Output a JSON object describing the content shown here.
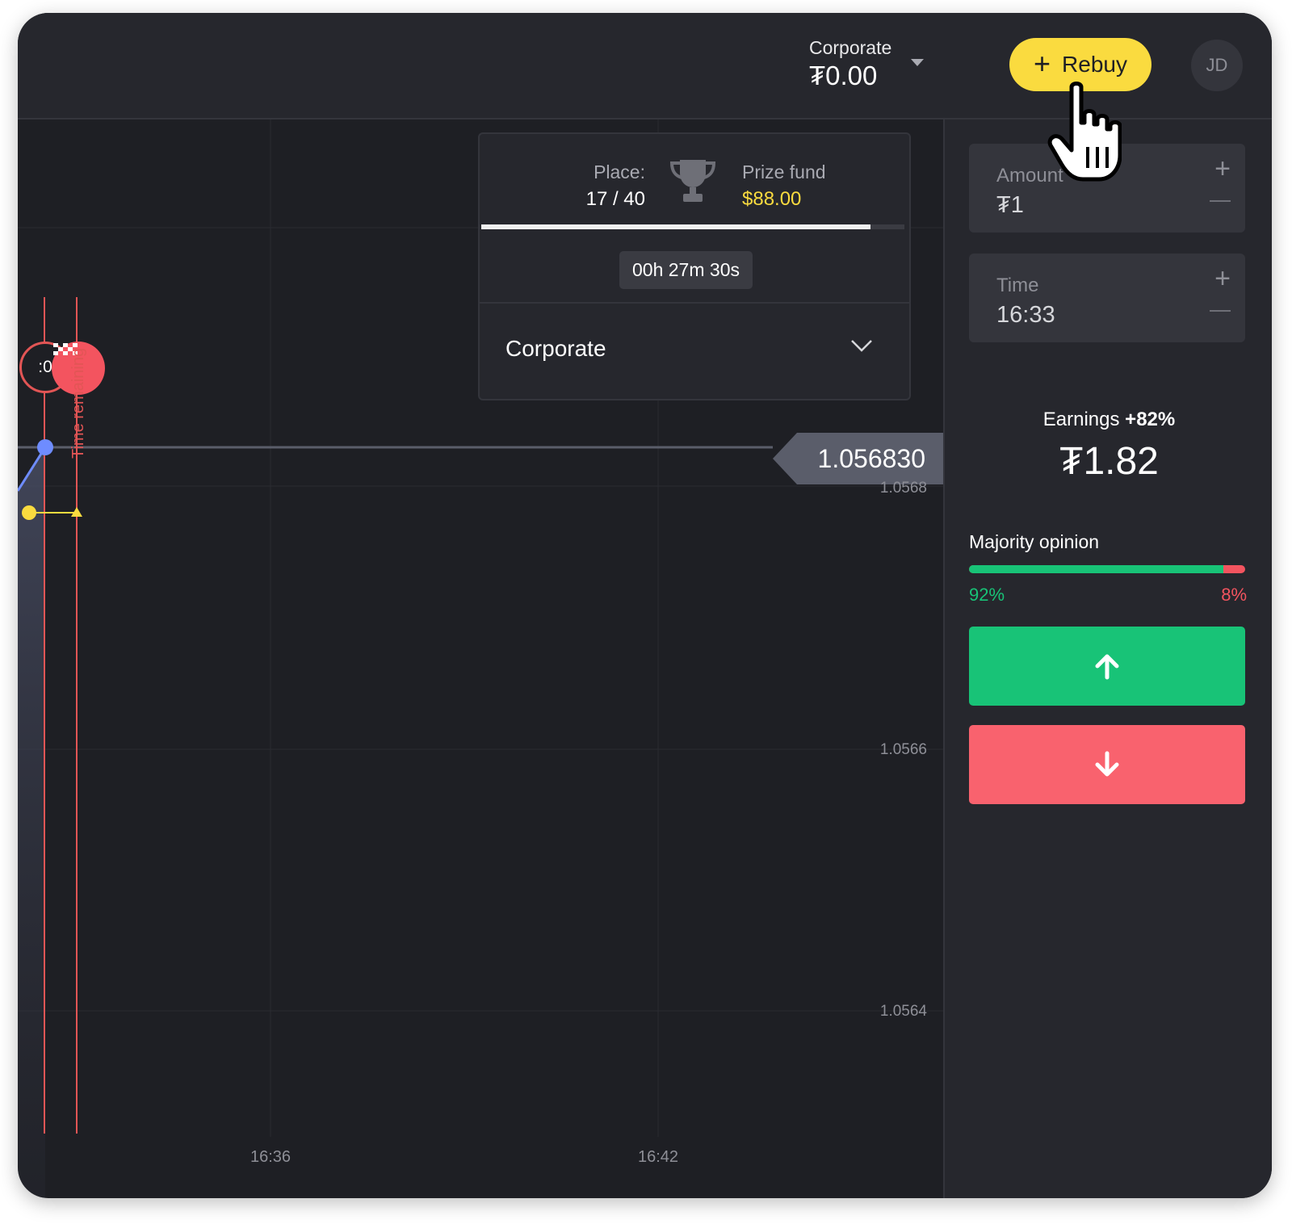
{
  "header": {
    "account_name": "Corporate",
    "balance": "₮0.00",
    "rebuy_label": "Rebuy",
    "avatar_initials": "JD"
  },
  "chart": {
    "current_price": "1.056830",
    "y_ticks": [
      "1.0568",
      "1.0566",
      "1.0564"
    ],
    "x_ticks": [
      "16:36",
      "16:42"
    ],
    "timer_badge": ":0",
    "time_remaining_label": "Time remaining"
  },
  "tournament": {
    "place_label": "Place:",
    "place_value": "17 / 40",
    "prize_label": "Prize fund",
    "prize_value": "$88.00",
    "progress": 0.92,
    "countdown": "00h 27m 30s",
    "selected": "Corporate"
  },
  "trade": {
    "amount_label": "Amount",
    "amount_value": "₮1",
    "time_label": "Time",
    "time_value": "16:33",
    "earnings_label": "Earnings",
    "earnings_pct": "+82%",
    "earnings_value": "₮1.82",
    "majority_label": "Majority opinion",
    "majority_up": "92%",
    "majority_down": "8%",
    "majority_up_fraction": 0.92
  },
  "colors": {
    "accent_yellow": "#fadb3f",
    "up_green": "#18c377",
    "down_red": "#f3545f",
    "background": "#1e1f24",
    "panel": "#26272d"
  },
  "icons": [
    "plus-icon",
    "caret-down-icon",
    "trophy-icon",
    "chevron-down-icon",
    "arrow-up-icon",
    "arrow-down-icon",
    "finish-flag-icon",
    "hand-pointer-icon"
  ]
}
